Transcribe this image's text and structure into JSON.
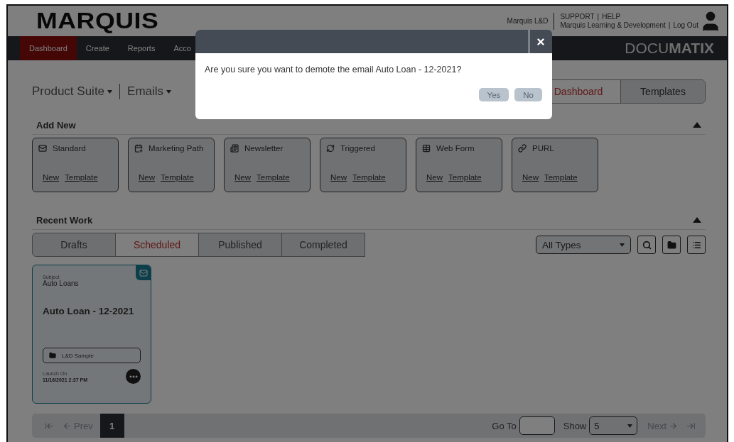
{
  "header": {
    "logo": "MARQUIS",
    "account": "Marquis L&D",
    "support": "SUPPORT",
    "separator": "|",
    "help": "HELP",
    "org": "Marquis Learning & Development",
    "logout": "Log Out"
  },
  "nav": {
    "items": [
      {
        "label": "Dashboard",
        "selected": true
      },
      {
        "label": "Create",
        "selected": false
      },
      {
        "label": "Reports",
        "selected": false
      },
      {
        "label": "Acco",
        "selected": false
      }
    ],
    "brand_light": "DOCU",
    "brand_bold": "MATIX"
  },
  "breadcrumbs": [
    {
      "label": "Product Suite"
    },
    {
      "label": "Emails"
    }
  ],
  "view_tabs": [
    {
      "label": "Dashboard",
      "selected": true
    },
    {
      "label": "Templates",
      "selected": false
    }
  ],
  "add_new": {
    "title": "Add New",
    "expanded": true,
    "items": [
      {
        "kind": "standard",
        "label": "Standard",
        "new": "New",
        "template": "Template"
      },
      {
        "kind": "path",
        "label": "Marketing Path",
        "new": "New",
        "template": "Template"
      },
      {
        "kind": "newsletter",
        "label": "Newsletter",
        "new": "New",
        "template": "Template"
      },
      {
        "kind": "triggered",
        "label": "Triggered",
        "new": "New",
        "template": "Template"
      },
      {
        "kind": "webform",
        "label": "Web Form",
        "new": "New",
        "template": "Template"
      },
      {
        "kind": "purl",
        "label": "PURL",
        "new": "New",
        "template": "Template"
      }
    ]
  },
  "recent_work": {
    "title": "Recent Work",
    "expanded": true,
    "tabs": [
      {
        "label": "Drafts",
        "selected": false
      },
      {
        "label": "Scheduled",
        "selected": true
      },
      {
        "label": "Published",
        "selected": false
      },
      {
        "label": "Completed",
        "selected": false
      }
    ],
    "filter": {
      "value": "All Types"
    },
    "cards": [
      {
        "subject_label": "Subject",
        "subject": "Auto Loans",
        "title": "Auto Loan - 12-2021",
        "folder": "L&D Sample",
        "launch_label": "Launch On",
        "launch": "11/16/2021 2:37 PM"
      }
    ]
  },
  "pagination": {
    "prev": {
      "label": "Prev",
      "disabled": true
    },
    "pages": [
      {
        "label": "1",
        "selected": true
      }
    ],
    "goto_label": "Go To",
    "show_label": "Show",
    "show_value": "5",
    "next": {
      "label": "Next",
      "disabled": true
    }
  },
  "dialog": {
    "message": "Are you sure you want to demote the email Auto Loan - 12-2021?",
    "buttons": [
      "Yes",
      "No"
    ]
  }
}
